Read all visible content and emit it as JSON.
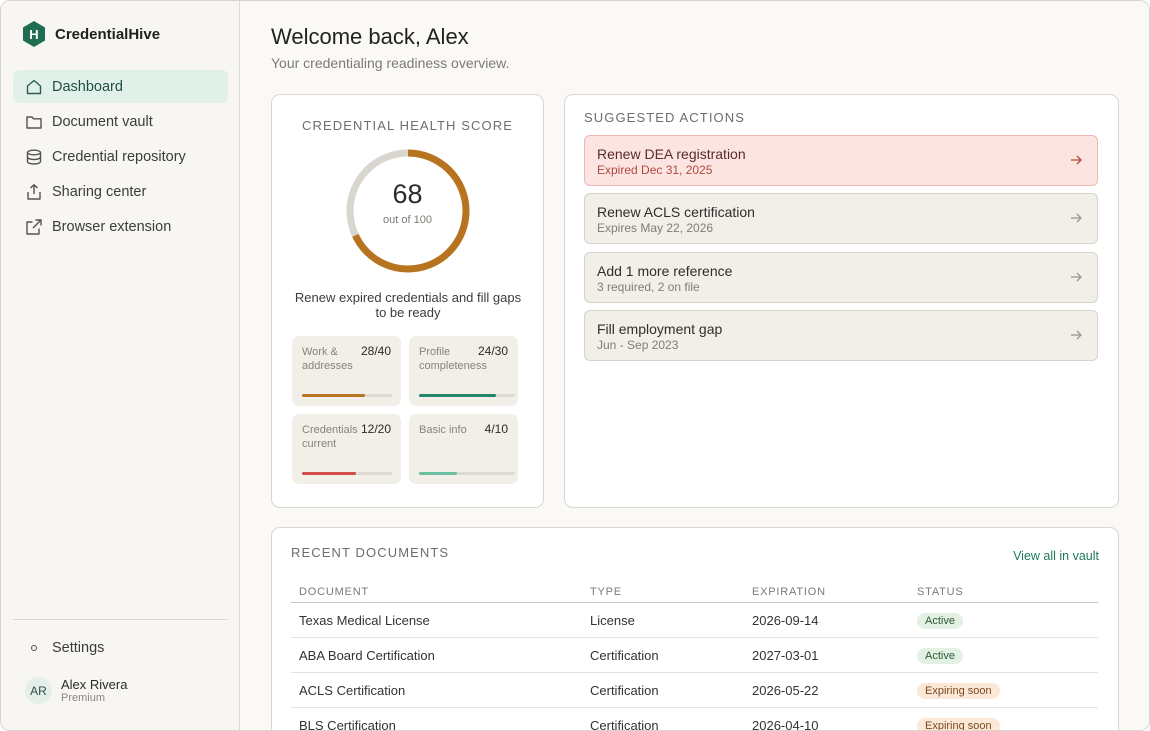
{
  "brand": {
    "name": "CredentialHive",
    "logo_letter": "H",
    "color": "#1f6e54"
  },
  "sidebar": {
    "items": [
      {
        "label": "Dashboard",
        "icon": "home-icon",
        "active": true
      },
      {
        "label": "Document vault",
        "icon": "folder-icon",
        "active": false
      },
      {
        "label": "Credential repository",
        "icon": "database-icon",
        "active": false
      },
      {
        "label": "Sharing center",
        "icon": "share-icon",
        "active": false
      },
      {
        "label": "Browser extension",
        "icon": "external-link-icon",
        "active": false
      }
    ],
    "settings_label": "Settings",
    "user": {
      "initials": "AR",
      "name": "Alex Rivera",
      "plan": "Premium"
    }
  },
  "header": {
    "title": "Welcome back, Alex",
    "subtitle": "Your credentialing readiness overview."
  },
  "health": {
    "label": "CREDENTIAL HEALTH SCORE",
    "score": "68",
    "score_sub": "out of 100",
    "score_fraction": 0.68,
    "message": "Renew expired credentials and fill gaps to be ready",
    "metrics": [
      {
        "label": "Work & addresses",
        "value": "28/40",
        "fraction": 0.7,
        "color": "#b8731e"
      },
      {
        "label": "Profile completeness",
        "value": "24/30",
        "fraction": 0.8,
        "color": "#22866a"
      },
      {
        "label": "Credentials current",
        "value": "12/20",
        "fraction": 0.6,
        "color": "#d24c4c"
      },
      {
        "label": "Basic info",
        "value": "4/10",
        "fraction": 0.4,
        "color": "#6ac2a2"
      }
    ]
  },
  "actions": {
    "label": "SUGGESTED ACTIONS",
    "items": [
      {
        "title": "Renew DEA registration",
        "sub": "Expired Dec 31, 2025",
        "urgent": true
      },
      {
        "title": "Renew ACLS certification",
        "sub": "Expires May 22, 2026",
        "urgent": false
      },
      {
        "title": "Add 1 more reference",
        "sub": "3 required, 2 on file",
        "urgent": false
      },
      {
        "title": "Fill employment gap",
        "sub": "Jun - Sep 2023",
        "urgent": false
      }
    ]
  },
  "recent": {
    "label": "RECENT DOCUMENTS",
    "view_all": "View all in vault",
    "columns": [
      "DOCUMENT",
      "TYPE",
      "EXPIRATION",
      "STATUS"
    ],
    "rows": [
      {
        "document": "Texas Medical License",
        "type": "License",
        "expiration": "2026-09-14",
        "status": "Active",
        "status_kind": "active"
      },
      {
        "document": "ABA Board Certification",
        "type": "Certification",
        "expiration": "2027-03-01",
        "status": "Active",
        "status_kind": "active"
      },
      {
        "document": "ACLS Certification",
        "type": "Certification",
        "expiration": "2026-05-22",
        "status": "Expiring soon",
        "status_kind": "expiring"
      },
      {
        "document": "BLS Certification",
        "type": "Certification",
        "expiration": "2026-04-10",
        "status": "Expiring soon",
        "status_kind": "expiring"
      }
    ]
  }
}
